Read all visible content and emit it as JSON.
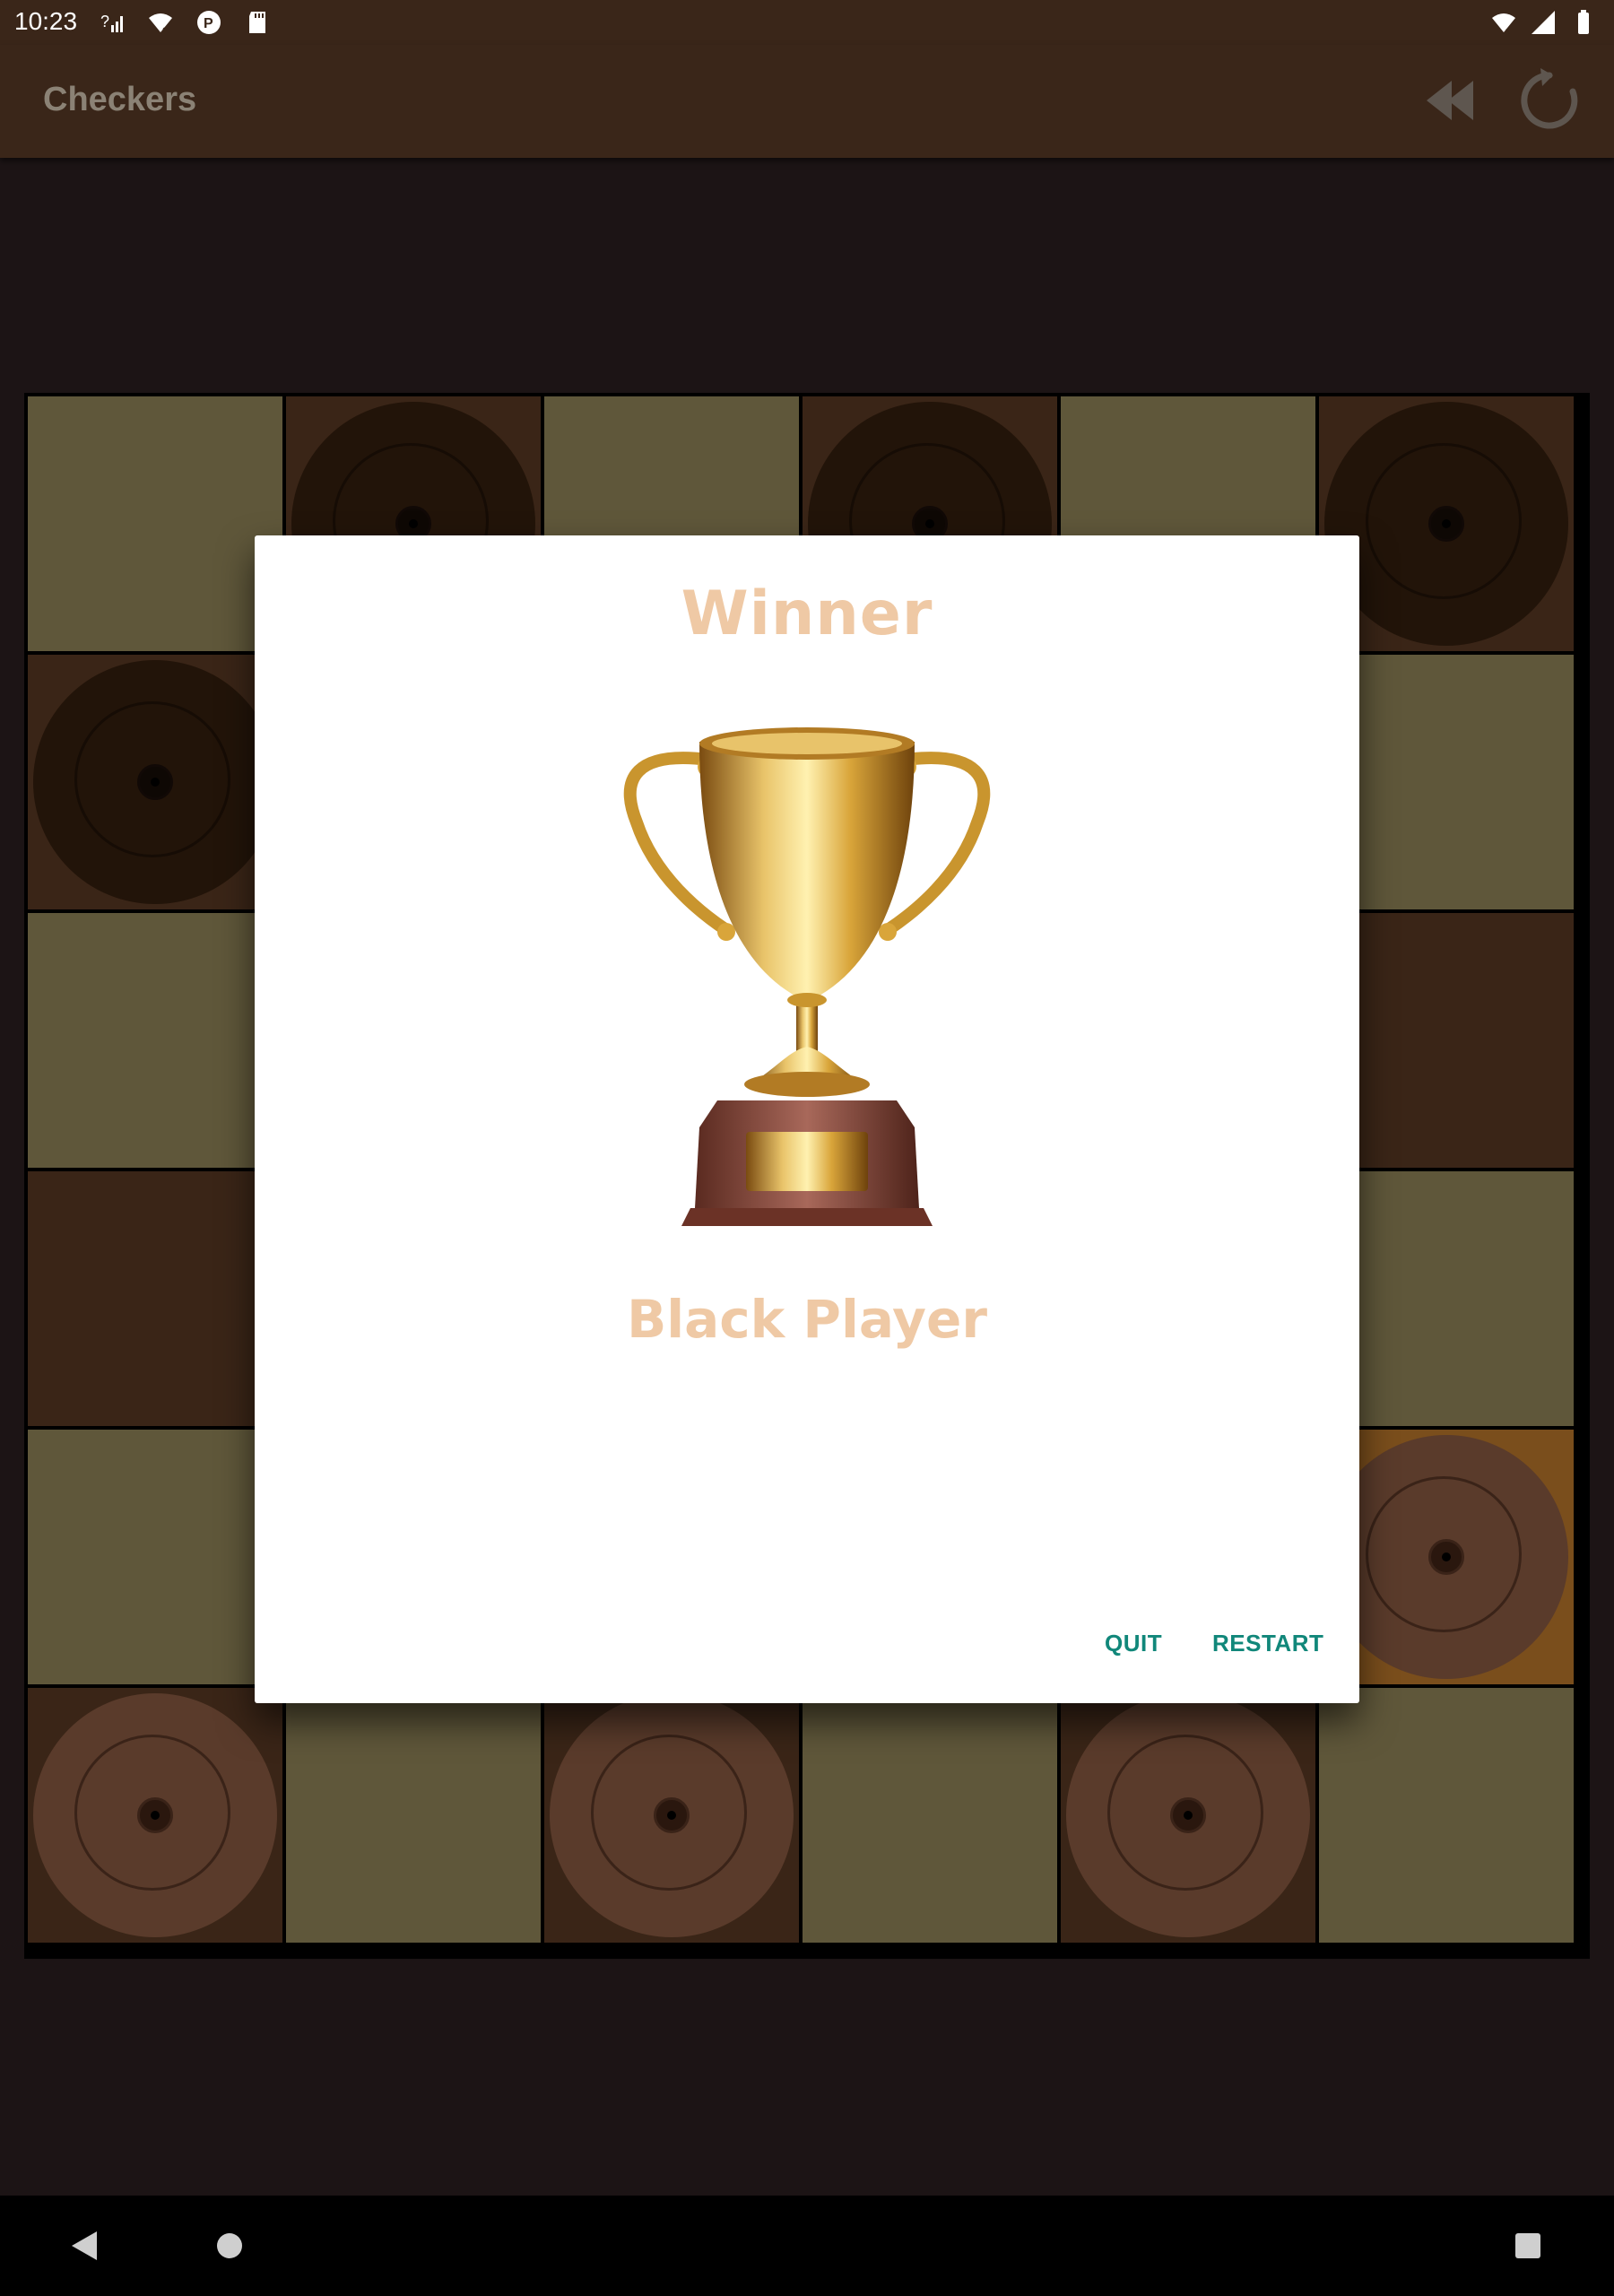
{
  "status_bar": {
    "time": "10:23"
  },
  "app_bar": {
    "title": "Checkers",
    "actions": [
      "rewind-icon",
      "restart-icon"
    ]
  },
  "board": {
    "rows": 6,
    "cols": 6,
    "cells": [
      [
        "light",
        "dark:black",
        "light",
        "dark:black",
        "light",
        "dark:black"
      ],
      [
        "dark:black",
        "light",
        "dark",
        "light",
        "dark",
        "light"
      ],
      [
        "light",
        "dark",
        "light",
        "dark",
        "light",
        "dark"
      ],
      [
        "dark",
        "light",
        "dark",
        "light",
        "dark",
        "light"
      ],
      [
        "light",
        "dark",
        "light",
        "dark",
        "light",
        "highlight:white"
      ],
      [
        "dark:white",
        "light",
        "dark:white",
        "light",
        "dark:white",
        "light"
      ]
    ],
    "colors": {
      "light": "#5f573a",
      "dark": "#3a2517",
      "highlight": "#7a4e1c"
    }
  },
  "dialog": {
    "title": "Winner",
    "winner": "Black Player",
    "image": "trophy-icon",
    "buttons": {
      "quit": "QUIT",
      "restart": "RESTART"
    },
    "accent_color": "#11877a",
    "title_color": "#efc9a5"
  },
  "nav_bar": {
    "buttons": [
      "back-icon",
      "home-icon",
      "recents-icon"
    ]
  }
}
